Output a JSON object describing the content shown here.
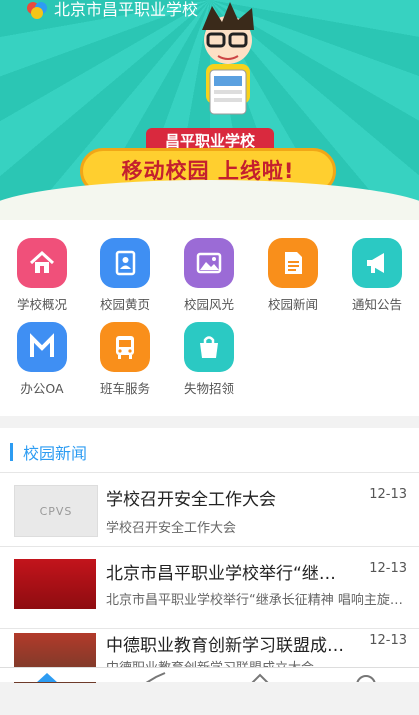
{
  "header": {
    "school_name": "北京市昌平职业学校"
  },
  "banner": {
    "ribbon_top": "昌平职业学校",
    "ribbon_main": "移动校园 上线啦!"
  },
  "menu": [
    {
      "label": "学校概况",
      "icon": "home-icon",
      "color": "#f0507a"
    },
    {
      "label": "校园黄页",
      "icon": "contacts-book-icon",
      "color": "#3f8ff3"
    },
    {
      "label": "校园风光",
      "icon": "image-icon",
      "color": "#9b6bd6"
    },
    {
      "label": "校园新闻",
      "icon": "document-icon",
      "color": "#f98f1b"
    },
    {
      "label": "通知公告",
      "icon": "megaphone-icon",
      "color": "#2bc9c3"
    },
    {
      "label": "办公OA",
      "icon": "office-m-icon",
      "color": "#3f8ff3"
    },
    {
      "label": "班车服务",
      "icon": "bus-icon",
      "color": "#f98f1b"
    },
    {
      "label": "失物招领",
      "icon": "bag-icon",
      "color": "#2bc9c3"
    }
  ],
  "news": {
    "section_title": "校园新闻",
    "items": [
      {
        "title": "学校召开安全工作大会",
        "date": "12-13",
        "summary": "学校召开安全工作大会",
        "thumb_text": "CPVS"
      },
      {
        "title": "北京市昌平职业学校举行“继承长征精神 唱响主旋律”合唱比赛",
        "date": "12-13",
        "summary": "北京市昌平职业学校举行“继承长征精神 唱响主旋律”合唱比赛"
      },
      {
        "title": "中德职业教育创新学习联盟成立大会",
        "date": "12-13",
        "summary": "中德职业教育创新学习联盟成立大会"
      }
    ]
  }
}
